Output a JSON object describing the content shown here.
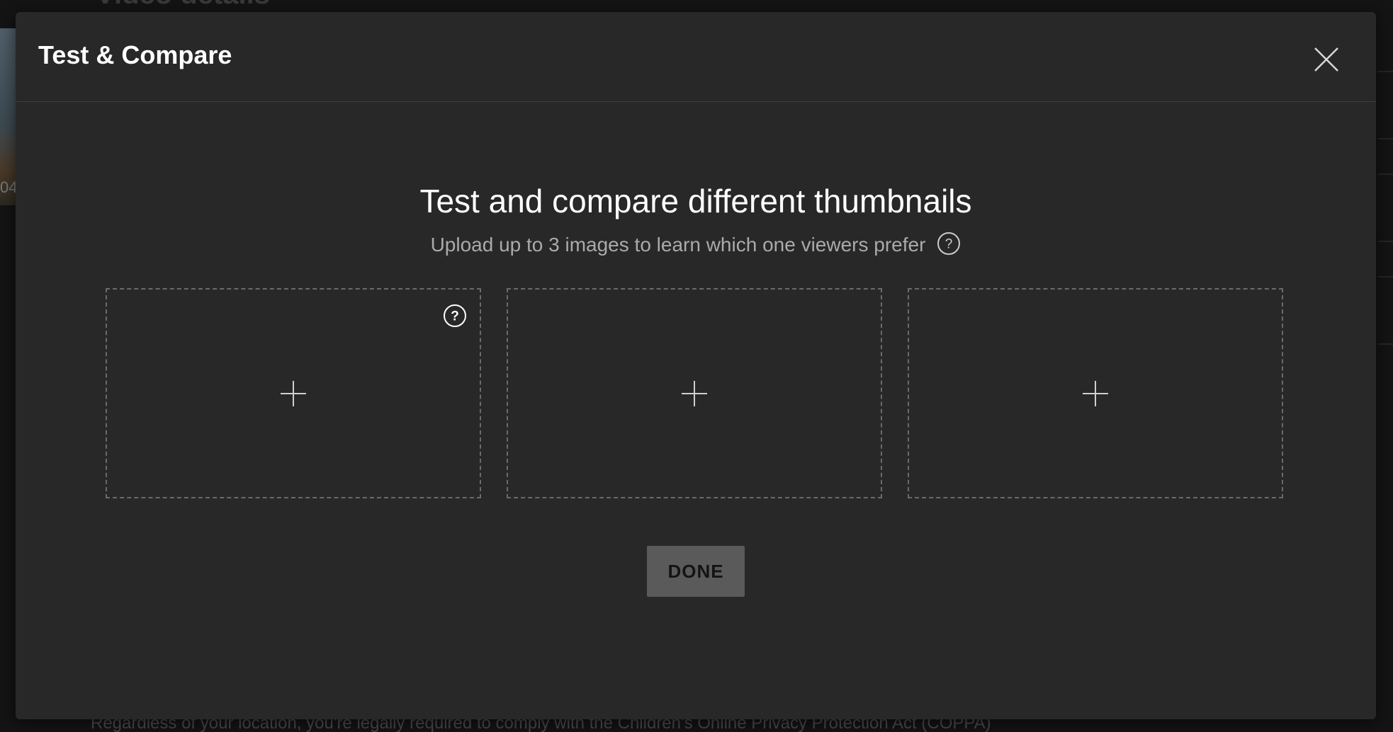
{
  "background": {
    "page_title": "Video details",
    "left_snippet": "04",
    "footer_text": "Regardless of your location, you're legally required to comply with the Children's Online Privacy Protection Act (COPPA)"
  },
  "dialog": {
    "title": "Test & Compare",
    "close_icon": "close-icon",
    "headline": "Test and compare different thumbnails",
    "subline": "Upload up to 3 images to learn which one viewers prefer",
    "help_icon": "help-circle-icon",
    "slots": [
      {
        "icon": "plus-icon",
        "has_help": true
      },
      {
        "icon": "plus-icon",
        "has_help": false
      },
      {
        "icon": "plus-icon",
        "has_help": false
      }
    ],
    "done_label": "DONE"
  },
  "colors": {
    "dialog_bg": "#282828",
    "dashed_border": "#6a6a6a",
    "done_bg": "#5a5a5a",
    "text_primary": "#ffffff",
    "text_secondary": "#aaaaaa"
  }
}
